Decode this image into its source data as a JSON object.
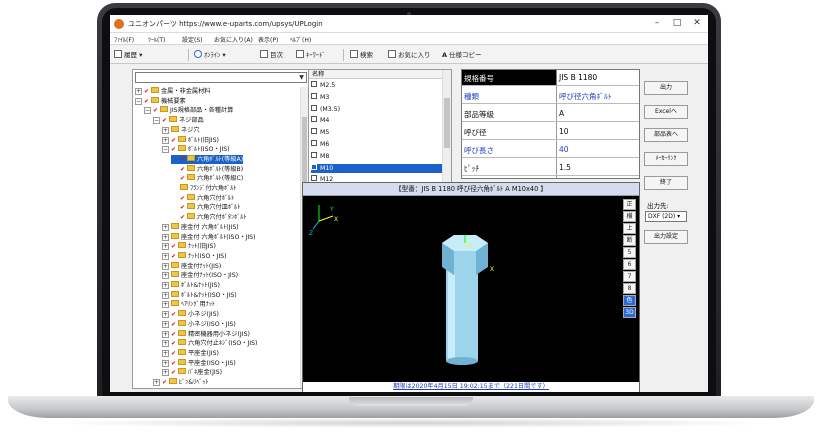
{
  "window": {
    "title": "ユニオンパーツ https://www.e-uparts.com/upsys/UPLogin",
    "min": "–",
    "max": "□",
    "close": "✕"
  },
  "menu": [
    "ﾌｧｲﾙ(F)",
    "ﾂｰﾙ(T)",
    "設定(S)",
    "お気に入り(A)",
    "表示(P)",
    "ﾍﾙﾌﾟ(H)"
  ],
  "toolbar": {
    "history": "履歴",
    "online": "ｵﾝﾗｲﾝ",
    "toc": "目次",
    "keyword": "ｷｰﾜｰﾄﾞ",
    "search": "検索",
    "favorites": "お気に入り",
    "spec_copy": "仕様コピー"
  },
  "tree": {
    "combo_value": "",
    "items": [
      {
        "label": "金属・非金属材料",
        "exp": "+",
        "type": "check"
      },
      {
        "label": "機械要素",
        "exp": "−",
        "type": "check"
      },
      {
        "label": "JIS規格部品・各種計算",
        "exp": "−",
        "type": "check"
      },
      {
        "label": "ネジ部品",
        "exp": "−",
        "type": "check"
      },
      {
        "label": "ネジ穴",
        "exp": "+",
        "type": "folder"
      },
      {
        "label": "ﾎﾞﾙﾄ(旧JIS)",
        "exp": "+",
        "type": "check"
      },
      {
        "label": "ﾎﾞﾙﾄ(ISO・JIS)",
        "exp": "−",
        "type": "check"
      },
      {
        "label": "六角ﾎﾞﾙﾄ(等級A)",
        "exp": "",
        "type": "check",
        "selected": true
      },
      {
        "label": "六角ﾎﾞﾙﾄ(等級B)",
        "exp": "",
        "type": "check"
      },
      {
        "label": "六角ﾎﾞﾙﾄ(等級C)",
        "exp": "",
        "type": "check"
      },
      {
        "label": "ﾌﾗﾝｼﾞ付六角ﾎﾞﾙﾄ",
        "exp": "",
        "type": "folder"
      },
      {
        "label": "六角穴付ﾎﾞﾙﾄ",
        "exp": "",
        "type": "check"
      },
      {
        "label": "六角穴付皿ﾎﾞﾙﾄ",
        "exp": "",
        "type": "check"
      },
      {
        "label": "六角穴付ﾎﾞﾀﾝﾎﾞﾙﾄ",
        "exp": "",
        "type": "check"
      },
      {
        "label": "座金付 六角ﾎﾞﾙﾄ(JIS)",
        "exp": "+",
        "type": "folder"
      },
      {
        "label": "座金付 六角ﾎﾞﾙﾄ(ISO・JIS)",
        "exp": "+",
        "type": "folder"
      },
      {
        "label": "ﾅｯﾄ(旧JIS)",
        "exp": "+",
        "type": "check"
      },
      {
        "label": "ﾅｯﾄ(ISO・JIS)",
        "exp": "+",
        "type": "check"
      },
      {
        "label": "座金付ﾅｯﾄ(JIS)",
        "exp": "+",
        "type": "folder"
      },
      {
        "label": "座金付ﾅｯﾄ(ISO・JIS)",
        "exp": "+",
        "type": "folder"
      },
      {
        "label": "ﾎﾞﾙﾄ&ﾅｯﾄ(JIS)",
        "exp": "+",
        "type": "folder"
      },
      {
        "label": "ﾎﾞﾙﾄ&ﾅｯﾄ(ISO・JIS)",
        "exp": "+",
        "type": "folder"
      },
      {
        "label": "ﾍｱﾘﾝｸﾞ用ﾅｯﾄ",
        "exp": "+",
        "type": "folder"
      },
      {
        "label": "小ネジ(JIS)",
        "exp": "+",
        "type": "check"
      },
      {
        "label": "小ネジ(ISO・JIS)",
        "exp": "+",
        "type": "check"
      },
      {
        "label": "精密機器用小ネジ(JIS)",
        "exp": "+",
        "type": "check"
      },
      {
        "label": "六角穴付止ﾈｼﾞ(ISO・JIS)",
        "exp": "+",
        "type": "check"
      },
      {
        "label": "平座金(JIS)",
        "exp": "+",
        "type": "check"
      },
      {
        "label": "平座金(ISO・JIS)",
        "exp": "+",
        "type": "check"
      },
      {
        "label": "ﾊﾞﾈ座金(JIS)",
        "exp": "+",
        "type": "check"
      },
      {
        "label": "ﾋﾟﾝ&ﾘﾍﾞｯﾄ",
        "exp": "+",
        "type": "check"
      }
    ]
  },
  "name_list": {
    "header": "名称",
    "items": [
      "M2.5",
      "M3",
      "(M3.5)",
      "M4",
      "M5",
      "M6",
      "M8",
      "M10",
      "M12"
    ],
    "selected": "M10"
  },
  "spec": {
    "rows": [
      {
        "k": "規格番号",
        "v": "JIS B 1180",
        "head": true
      },
      {
        "k": "種類",
        "v": "呼び径六角ﾎﾞﾙﾄ",
        "blue": true
      },
      {
        "k": "部品等級",
        "v": "A"
      },
      {
        "k": "呼び径",
        "v": "10"
      },
      {
        "k": "呼び長さ",
        "v": "40",
        "blue": true
      },
      {
        "k": "ﾋﾟｯﾁ",
        "v": "1.5"
      }
    ]
  },
  "right_panel": {
    "output": "出力",
    "to_excel": "Excelへ",
    "to_parts_table": "部品表へ",
    "maker_link": "ﾒｰｶｰﾘﾝｸ",
    "exit": "終了",
    "output_to_label": "出力先:",
    "output_to_value": "DXF (2D)",
    "output_settings": "出力設定"
  },
  "viewer": {
    "title": "【型番：JIS B 1180 呼び径六角ﾎﾞﾙﾄ A M10x40 】",
    "status": "期限は2020年4月15日 19:02:15まで（221日間です）",
    "tabs": [
      "正",
      "横",
      "上",
      "断",
      "5",
      "6",
      "7",
      "8",
      "色",
      "3D"
    ],
    "active_tab": "3D",
    "axis_labels": {
      "x": "X",
      "y": "Y",
      "z": "Z"
    },
    "colors": {
      "bolt": "#9cd4ec",
      "bolt_dark": "#6fb2d2",
      "bolt_light": "#c7ecfa",
      "axis_x": "#ffff00",
      "axis_y": "#00ff00",
      "axis_z": "#00c8ff"
    }
  }
}
